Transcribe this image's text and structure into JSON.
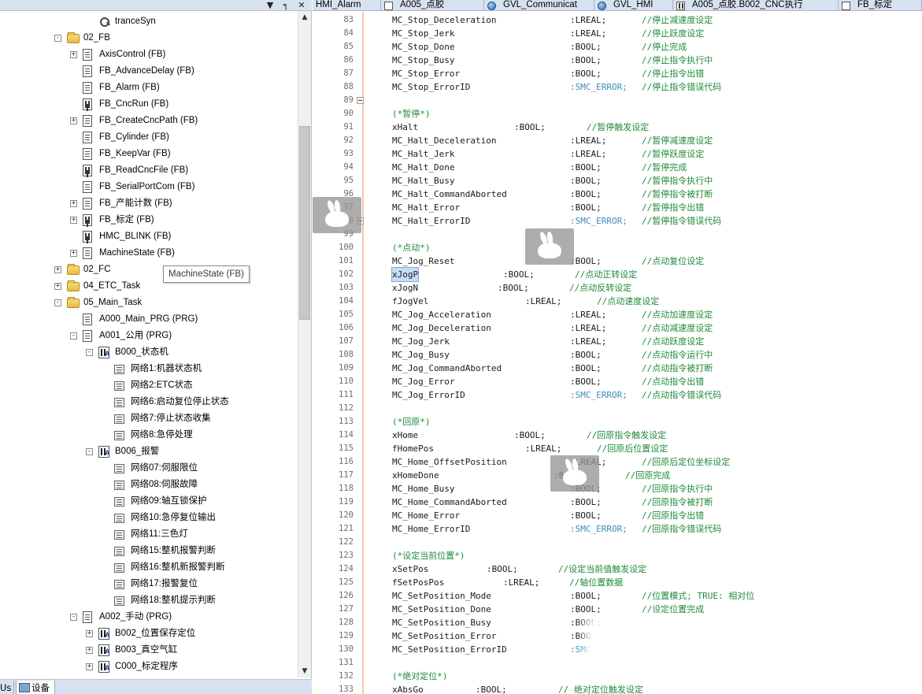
{
  "left_panel": {
    "title_buttons": [
      "▼",
      "╕",
      "✕"
    ],
    "tree": [
      {
        "depth": 4,
        "icon": "trace",
        "label": "tranceSyn",
        "expander": ""
      },
      {
        "depth": 2,
        "icon": "folder",
        "label": "02_FB",
        "expander": "-"
      },
      {
        "depth": 3,
        "icon": "doc",
        "label": "AxisControl (FB)",
        "expander": "+"
      },
      {
        "depth": 3,
        "icon": "doc",
        "label": "FB_AdvanceDelay (FB)",
        "expander": ""
      },
      {
        "depth": 3,
        "icon": "doc",
        "label": "FB_Alarm (FB)",
        "expander": ""
      },
      {
        "depth": 3,
        "icon": "fbdoc",
        "label": "FB_CncRun (FB)",
        "expander": ""
      },
      {
        "depth": 3,
        "icon": "doc",
        "label": "FB_CreateCncPath (FB)",
        "expander": "+"
      },
      {
        "depth": 3,
        "icon": "doc",
        "label": "FB_Cylinder (FB)",
        "expander": ""
      },
      {
        "depth": 3,
        "icon": "doc",
        "label": "FB_KeepVar (FB)",
        "expander": ""
      },
      {
        "depth": 3,
        "icon": "fbdoc",
        "label": "FB_ReadCncFile (FB)",
        "expander": ""
      },
      {
        "depth": 3,
        "icon": "doc",
        "label": "FB_SerialPortCom (FB)",
        "expander": ""
      },
      {
        "depth": 3,
        "icon": "doc",
        "label": "FB_产能计数 (FB)",
        "expander": "+"
      },
      {
        "depth": 3,
        "icon": "fbdoc",
        "label": "FB_标定 (FB)",
        "expander": "+"
      },
      {
        "depth": 3,
        "icon": "fbdoc",
        "label": "HMC_BLINK (FB)",
        "expander": ""
      },
      {
        "depth": 3,
        "icon": "doc",
        "label": "MachineState (FB)",
        "expander": "+"
      },
      {
        "depth": 2,
        "icon": "folder",
        "label": "02_FC",
        "expander": "+"
      },
      {
        "depth": 2,
        "icon": "folder",
        "label": "04_ETC_Task",
        "expander": "+"
      },
      {
        "depth": 2,
        "icon": "folder",
        "label": "05_Main_Task",
        "expander": "-"
      },
      {
        "depth": 3,
        "icon": "doc",
        "label": "A000_Main_PRG (PRG)",
        "expander": ""
      },
      {
        "depth": 3,
        "icon": "doc",
        "label": "A001_公用 (PRG)",
        "expander": "-"
      },
      {
        "depth": 4,
        "icon": "ladder",
        "label": "B000_状态机",
        "expander": "-"
      },
      {
        "depth": 5,
        "icon": "net",
        "label": "网络1:机器状态机",
        "expander": ""
      },
      {
        "depth": 5,
        "icon": "net",
        "label": "网络2:ETC状态",
        "expander": ""
      },
      {
        "depth": 5,
        "icon": "net",
        "label": "网络6:启动复位停止状态",
        "expander": ""
      },
      {
        "depth": 5,
        "icon": "net",
        "label": "网络7:停止状态收集",
        "expander": ""
      },
      {
        "depth": 5,
        "icon": "net",
        "label": "网络8:急停处理",
        "expander": ""
      },
      {
        "depth": 4,
        "icon": "ladder",
        "label": "B006_报警",
        "expander": "-"
      },
      {
        "depth": 5,
        "icon": "net",
        "label": "网络07:伺服限位",
        "expander": ""
      },
      {
        "depth": 5,
        "icon": "net",
        "label": "网络08:伺服故障",
        "expander": ""
      },
      {
        "depth": 5,
        "icon": "net",
        "label": "网络09:轴互锁保护",
        "expander": ""
      },
      {
        "depth": 5,
        "icon": "net",
        "label": "网络10:急停复位输出",
        "expander": ""
      },
      {
        "depth": 5,
        "icon": "net",
        "label": "网络11:三色灯",
        "expander": ""
      },
      {
        "depth": 5,
        "icon": "net",
        "label": "网络15:整机报警判断",
        "expander": ""
      },
      {
        "depth": 5,
        "icon": "net",
        "label": "网络16:整机新报警判断",
        "expander": ""
      },
      {
        "depth": 5,
        "icon": "net",
        "label": "网络17:报警复位",
        "expander": ""
      },
      {
        "depth": 5,
        "icon": "net",
        "label": "网络18:整机提示判断",
        "expander": ""
      },
      {
        "depth": 3,
        "icon": "doc",
        "label": "A002_手动 (PRG)",
        "expander": "-"
      },
      {
        "depth": 4,
        "icon": "ladder",
        "label": "B002_位置保存定位",
        "expander": "+"
      },
      {
        "depth": 4,
        "icon": "ladder",
        "label": "B003_真空气缸",
        "expander": "+"
      },
      {
        "depth": 4,
        "icon": "ladder",
        "label": "C000_标定程序",
        "expander": "+"
      }
    ],
    "tooltip": "MachineState (FB)",
    "bottom_tabs": {
      "us": "Us",
      "devices": "设备"
    }
  },
  "editor_tabs": [
    {
      "label": "HMI_Alarm",
      "icon": "none"
    },
    {
      "label": "A005_点胶",
      "icon": "prog"
    },
    {
      "label": "GVL_Communicat",
      "icon": "globe"
    },
    {
      "label": "GVL_HMI",
      "icon": "globe"
    },
    {
      "label": "A005_点胶.B002_CNC执行",
      "icon": "fb"
    },
    {
      "label": "FB_标定",
      "icon": "prog"
    }
  ],
  "code_lines": [
    {
      "ln": "83",
      "fold": false,
      "parts": [
        [
          "MC_Stop_Deceleration",
          0,
          "name"
        ],
        [
          ":LREAL;",
          226,
          "type"
        ],
        [
          "//停止减速度设定",
          317,
          "cmt"
        ]
      ]
    },
    {
      "ln": "84",
      "fold": false,
      "parts": [
        [
          "MC_Stop_Jerk",
          0,
          "name"
        ],
        [
          ":LREAL;",
          226,
          "type"
        ],
        [
          "//停止跃度设定",
          317,
          "cmt"
        ]
      ]
    },
    {
      "ln": "85",
      "fold": false,
      "parts": [
        [
          "MC_Stop_Done",
          0,
          "name"
        ],
        [
          ":BOOL;",
          226,
          "type"
        ],
        [
          "//停止完成",
          317,
          "cmt"
        ]
      ]
    },
    {
      "ln": "86",
      "fold": false,
      "parts": [
        [
          "MC_Stop_Busy",
          0,
          "name"
        ],
        [
          ":BOOL;",
          226,
          "type"
        ],
        [
          "//停止指令执行中",
          317,
          "cmt"
        ]
      ]
    },
    {
      "ln": "87",
      "fold": false,
      "parts": [
        [
          "MC_Stop_Error",
          0,
          "name"
        ],
        [
          ":BOOL;",
          226,
          "type"
        ],
        [
          "//停止指令出错",
          317,
          "cmt"
        ]
      ]
    },
    {
      "ln": "88",
      "fold": false,
      "parts": [
        [
          "MC_Stop_ErrorID",
          0,
          "name"
        ],
        [
          ":SMC_ERROR;",
          226,
          "stype"
        ],
        [
          "//停止指令错误代码",
          317,
          "cmt"
        ]
      ]
    },
    {
      "ln": "89",
      "fold": true,
      "parts": []
    },
    {
      "ln": "90",
      "fold": false,
      "parts": [
        [
          "(*暂停*)",
          0,
          "cmt"
        ]
      ]
    },
    {
      "ln": "91",
      "fold": false,
      "parts": [
        [
          "xHalt",
          0,
          "name"
        ],
        [
          ":BOOL;",
          155,
          "type"
        ],
        [
          "//暂停触发设定",
          247,
          "cmt"
        ]
      ]
    },
    {
      "ln": "92",
      "fold": false,
      "parts": [
        [
          "MC_Halt_Deceleration",
          0,
          "name"
        ],
        [
          ":LREAL;",
          226,
          "type"
        ],
        [
          "//暂停减速度设定",
          317,
          "cmt"
        ]
      ]
    },
    {
      "ln": "93",
      "fold": false,
      "parts": [
        [
          "MC_Halt_Jerk",
          0,
          "name"
        ],
        [
          ":LREAL;",
          226,
          "type"
        ],
        [
          "//暂停跃度设定",
          317,
          "cmt"
        ]
      ]
    },
    {
      "ln": "94",
      "fold": false,
      "parts": [
        [
          "MC_Halt_Done",
          0,
          "name"
        ],
        [
          ":BOOL;",
          226,
          "type"
        ],
        [
          "//暂停完成",
          317,
          "cmt"
        ]
      ]
    },
    {
      "ln": "95",
      "fold": false,
      "parts": [
        [
          "MC_Halt_Busy",
          0,
          "name"
        ],
        [
          ":BOOL;",
          226,
          "type"
        ],
        [
          "//暂停指令执行中",
          317,
          "cmt"
        ]
      ]
    },
    {
      "ln": "96",
      "fold": false,
      "parts": [
        [
          "MC_Halt_CommandAborted",
          0,
          "name"
        ],
        [
          ":BOOL;",
          226,
          "type"
        ],
        [
          "//暂停指令被打断",
          317,
          "cmt"
        ]
      ]
    },
    {
      "ln": "97",
      "fold": false,
      "parts": [
        [
          "MC_Halt_Error",
          0,
          "name"
        ],
        [
          ":BOOL;",
          226,
          "type"
        ],
        [
          "//暂停指令出错",
          317,
          "cmt"
        ]
      ]
    },
    {
      "ln": "98",
      "fold": true,
      "parts": [
        [
          "MC_Halt_ErrorID",
          0,
          "name"
        ],
        [
          ":SMC_ERROR;",
          226,
          "stype"
        ],
        [
          "//暂停指令错误代码",
          317,
          "cmt"
        ]
      ]
    },
    {
      "ln": "99",
      "fold": false,
      "parts": []
    },
    {
      "ln": "100",
      "fold": false,
      "parts": [
        [
          "(*点动*)",
          0,
          "cmt"
        ]
      ]
    },
    {
      "ln": "101",
      "fold": false,
      "parts": [
        [
          "MC_Jog_Reset",
          0,
          "name"
        ],
        [
          ":BOOL;",
          226,
          "type"
        ],
        [
          "//点动复位设定",
          317,
          "cmt"
        ]
      ]
    },
    {
      "ln": "102",
      "fold": false,
      "parts": [
        [
          "xJogP",
          0,
          "sel"
        ],
        [
          ":BOOL;",
          141,
          "type"
        ],
        [
          "//点动正转设定",
          232,
          "cmt"
        ]
      ]
    },
    {
      "ln": "103",
      "fold": false,
      "parts": [
        [
          "xJogN",
          0,
          "name"
        ],
        [
          ":BOOL;",
          134,
          "type"
        ],
        [
          "//点动反转设定",
          225,
          "cmt"
        ]
      ]
    },
    {
      "ln": "104",
      "fold": false,
      "parts": [
        [
          "fJogVel",
          0,
          "name"
        ],
        [
          ":LREAL;",
          169,
          "type"
        ],
        [
          "//点动速度设定",
          260,
          "cmt"
        ]
      ]
    },
    {
      "ln": "105",
      "fold": false,
      "parts": [
        [
          "MC_Jog_Acceleration",
          0,
          "name"
        ],
        [
          ":LREAL;",
          226,
          "type"
        ],
        [
          "//点动加速度设定",
          317,
          "cmt"
        ]
      ]
    },
    {
      "ln": "106",
      "fold": false,
      "parts": [
        [
          "MC_Jog_Deceleration",
          0,
          "name"
        ],
        [
          ":LREAL;",
          226,
          "type"
        ],
        [
          "//点动减速度设定",
          317,
          "cmt"
        ]
      ]
    },
    {
      "ln": "107",
      "fold": false,
      "parts": [
        [
          "MC_Jog_Jerk",
          0,
          "name"
        ],
        [
          ":LREAL;",
          226,
          "type"
        ],
        [
          "//点动跃度设定",
          317,
          "cmt"
        ]
      ]
    },
    {
      "ln": "108",
      "fold": false,
      "parts": [
        [
          "MC_Jog_Busy",
          0,
          "name"
        ],
        [
          ":BOOL;",
          226,
          "type"
        ],
        [
          "//点动指令运行中",
          317,
          "cmt"
        ]
      ]
    },
    {
      "ln": "109",
      "fold": false,
      "parts": [
        [
          "MC_Jog_CommandAborted",
          0,
          "name"
        ],
        [
          ":BOOL;",
          226,
          "type"
        ],
        [
          "//点动指令被打断",
          317,
          "cmt"
        ]
      ]
    },
    {
      "ln": "110",
      "fold": false,
      "parts": [
        [
          "MC_Jog_Error",
          0,
          "name"
        ],
        [
          ":BOOL;",
          226,
          "type"
        ],
        [
          "//点动指令出错",
          317,
          "cmt"
        ]
      ]
    },
    {
      "ln": "111",
      "fold": false,
      "parts": [
        [
          "MC_Jog_ErrorID",
          0,
          "name"
        ],
        [
          ":SMC_ERROR;",
          226,
          "stype"
        ],
        [
          "//点动指令错误代码",
          317,
          "cmt"
        ]
      ]
    },
    {
      "ln": "112",
      "fold": false,
      "parts": []
    },
    {
      "ln": "113",
      "fold": false,
      "parts": [
        [
          "(*回原*)",
          0,
          "cmt"
        ]
      ]
    },
    {
      "ln": "114",
      "fold": false,
      "parts": [
        [
          "xHome",
          0,
          "name"
        ],
        [
          ":BOOL;",
          155,
          "type"
        ],
        [
          "//回原指令触发设定",
          247,
          "cmt"
        ]
      ]
    },
    {
      "ln": "115",
      "fold": false,
      "parts": [
        [
          "fHomePos",
          0,
          "name"
        ],
        [
          ":LREAL;",
          169,
          "type"
        ],
        [
          "//回原后位置设定",
          260,
          "cmt"
        ]
      ]
    },
    {
      "ln": "116",
      "fold": false,
      "parts": [
        [
          "MC_Home_OffsetPosition",
          0,
          "name"
        ],
        [
          ":LREAL;",
          226,
          "type"
        ],
        [
          "//回原后定位坐标设定",
          317,
          "cmt"
        ]
      ]
    },
    {
      "ln": "117",
      "fold": false,
      "parts": [
        [
          "xHomeDone",
          0,
          "name"
        ],
        [
          ":BOOL;",
          205,
          "type"
        ],
        [
          "//回原完成",
          296,
          "cmt"
        ]
      ]
    },
    {
      "ln": "118",
      "fold": false,
      "parts": [
        [
          "MC_Home_Busy",
          0,
          "name"
        ],
        [
          ":BOOL;",
          226,
          "type"
        ],
        [
          "//回原指令执行中",
          317,
          "cmt"
        ]
      ]
    },
    {
      "ln": "119",
      "fold": false,
      "parts": [
        [
          "MC_Home_CommandAborted",
          0,
          "name"
        ],
        [
          ":BOOL;",
          226,
          "type"
        ],
        [
          "//回原指令被打断",
          317,
          "cmt"
        ]
      ]
    },
    {
      "ln": "120",
      "fold": false,
      "parts": [
        [
          "MC_Home_Error",
          0,
          "name"
        ],
        [
          ":BOOL;",
          226,
          "type"
        ],
        [
          "//回原指令出错",
          317,
          "cmt"
        ]
      ]
    },
    {
      "ln": "121",
      "fold": false,
      "parts": [
        [
          "MC_Home_ErrorID",
          0,
          "name"
        ],
        [
          ":SMC_ERROR;",
          226,
          "stype"
        ],
        [
          "//回原指令错误代码",
          317,
          "cmt"
        ]
      ]
    },
    {
      "ln": "122",
      "fold": false,
      "parts": []
    },
    {
      "ln": "123",
      "fold": false,
      "parts": [
        [
          "(*设定当前位置*)",
          0,
          "cmt"
        ]
      ]
    },
    {
      "ln": "124",
      "fold": false,
      "parts": [
        [
          "xSetPos",
          0,
          "name"
        ],
        [
          ":BOOL;",
          120,
          "type"
        ],
        [
          "//设定当前值触发设定",
          211,
          "cmt"
        ]
      ]
    },
    {
      "ln": "125",
      "fold": false,
      "parts": [
        [
          "fSetPosPos",
          0,
          "name"
        ],
        [
          ":LREAL;",
          141,
          "type"
        ],
        [
          "//轴位置数据",
          225,
          "cmt"
        ]
      ]
    },
    {
      "ln": "126",
      "fold": false,
      "parts": [
        [
          "MC_SetPosition_Mode",
          0,
          "name"
        ],
        [
          ":BOOL;",
          226,
          "type"
        ],
        [
          "//位置模式; TRUE: 相对位",
          317,
          "cmt"
        ]
      ]
    },
    {
      "ln": "127",
      "fold": false,
      "parts": [
        [
          "MC_SetPosition_Done",
          0,
          "name"
        ],
        [
          ":BOOL;",
          226,
          "type"
        ],
        [
          "//设定位置完成",
          317,
          "cmt"
        ]
      ]
    },
    {
      "ln": "128",
      "fold": false,
      "parts": [
        [
          "MC_SetPosition_Busy",
          0,
          "name"
        ],
        [
          ":BOOL;",
          226,
          "type"
        ]
      ]
    },
    {
      "ln": "129",
      "fold": false,
      "parts": [
        [
          "MC_SetPosition_Error",
          0,
          "name"
        ],
        [
          ":BOO",
          226,
          "type"
        ]
      ]
    },
    {
      "ln": "130",
      "fold": false,
      "parts": [
        [
          "MC_SetPosition_ErrorID",
          0,
          "name"
        ],
        [
          ":SMC",
          226,
          "stype"
        ]
      ]
    },
    {
      "ln": "131",
      "fold": false,
      "parts": []
    },
    {
      "ln": "132",
      "fold": false,
      "parts": [
        [
          "(*绝对定位*)",
          0,
          "cmt"
        ]
      ]
    },
    {
      "ln": "133",
      "fold": false,
      "parts": [
        [
          "xAbsGo",
          0,
          "name"
        ],
        [
          ":BOOL;",
          106,
          "type"
        ],
        [
          "// 绝对定位触发设定",
          211,
          "cmt"
        ]
      ]
    }
  ]
}
